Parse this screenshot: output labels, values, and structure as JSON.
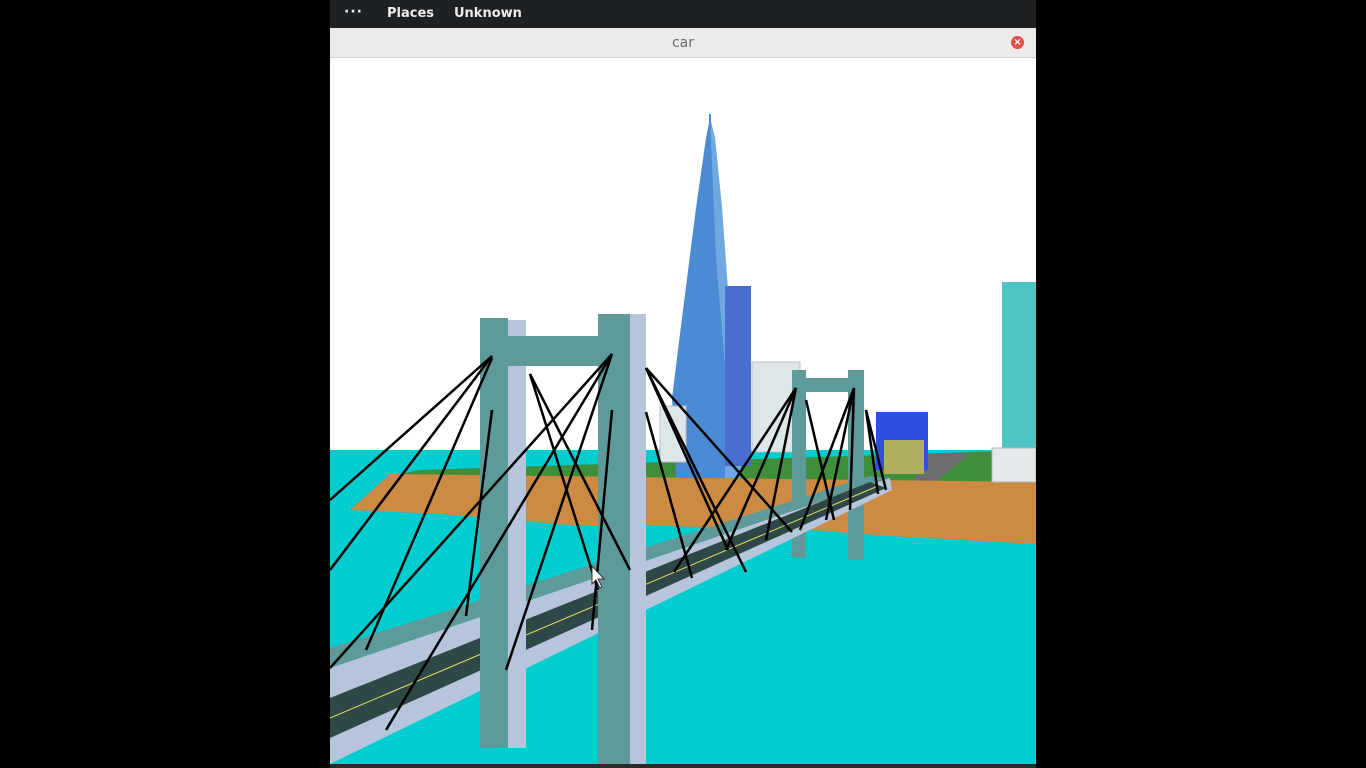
{
  "topbar": {
    "menu_icon": "ellipsis-icon",
    "dots": "···",
    "places_label": "Places",
    "unknown_label": "Unknown"
  },
  "window": {
    "title": "car",
    "close_icon": "close-icon"
  },
  "scene": {
    "sky_color": "#ffffff",
    "water_color": "#00cdd0",
    "sand_color": "#cd8a43",
    "grass_color": "#3f8f3a",
    "tower_color": "#5e9a9a",
    "tower_light_color": "#b7c5dc",
    "road_color": "#2e4747",
    "cable_color": "#000000",
    "spire_color": "#4a8bd4"
  }
}
